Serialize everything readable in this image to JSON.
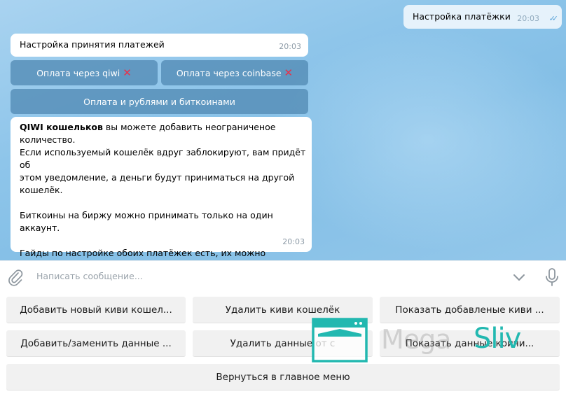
{
  "outgoing": {
    "text": "Настройка платёжки",
    "time": "20:03",
    "checks": "✓✓"
  },
  "header_message": {
    "text": "Настройка принятия платежей",
    "time": "20:03"
  },
  "inline_buttons": [
    {
      "label": "Оплата через qiwi",
      "mark": "✕"
    },
    {
      "label": "Оплата через coinbase",
      "mark": "✕"
    },
    {
      "label": "Оплата и рублями и биткоинами"
    }
  ],
  "info_message": {
    "bold": "QIWI кошельков",
    "text": " вы можете добавить неограниченое\nколичество.\nЕсли используемый кошелёк вдруг заблокируют, вам придёт об\nэтом уведомление, а деньги будут приниматься на другой\nкошелёк.\n\nБиткоины на биржу можно принимать только на один аккаунт.\n\nГайды по настройке обоих платёжек есть, их можно получить\nпри добавление соотвествующей платёжки",
    "time": "20:03"
  },
  "input": {
    "placeholder": "Написать сообщение..."
  },
  "keyboard": {
    "row1": [
      "Добавить новый киви кошел...",
      "Удалить киви кошелёк",
      "Показать добавленые киви ..."
    ],
    "row2": [
      "Добавить/заменить данные ...",
      "Удалить данные от с",
      "Показать данные коичи..."
    ],
    "row3": [
      "Вернуться в главное меню"
    ]
  },
  "watermark": {
    "text": "Mega",
    "brand": "Sliv"
  }
}
